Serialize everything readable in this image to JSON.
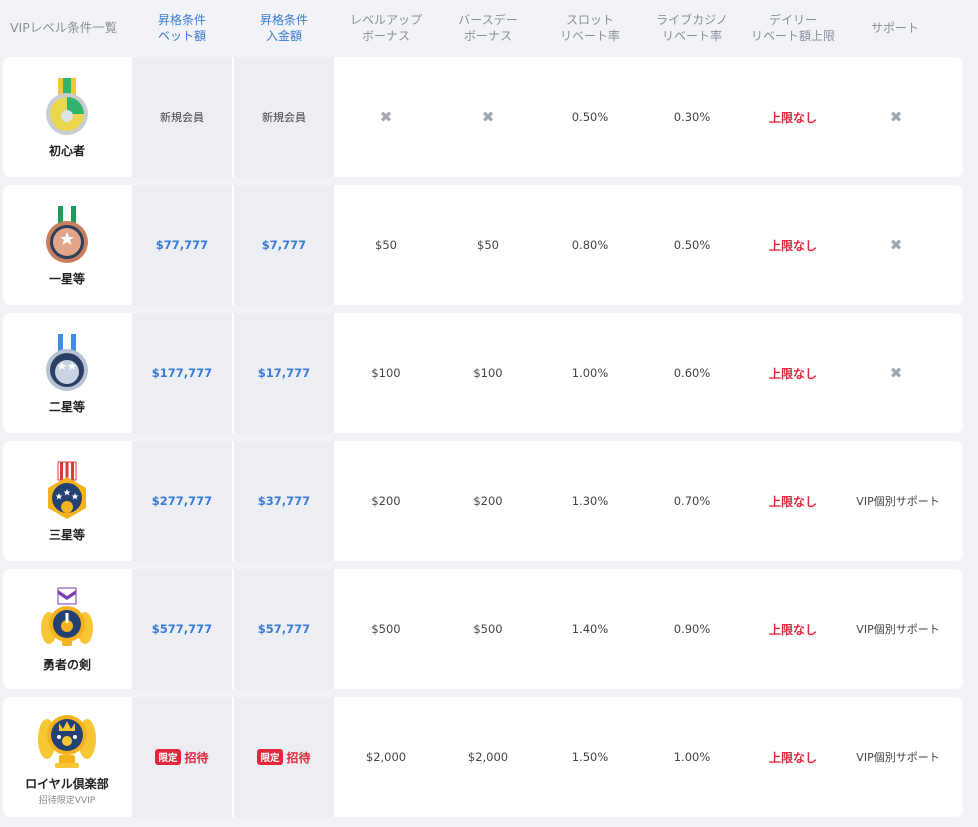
{
  "header": {
    "title": "VIPレベル条件一覧",
    "bet": [
      "昇格条件",
      "ベット額"
    ],
    "deposit": [
      "昇格条件",
      "入金額"
    ],
    "levelup": [
      "レベルアップ",
      "ボーナス"
    ],
    "birthday": [
      "バースデー",
      "ボーナス"
    ],
    "slot": [
      "スロット",
      "リベート率"
    ],
    "live": [
      "ライブカジノ",
      "リベート率"
    ],
    "daily": [
      "デイリー",
      "リベート額上限"
    ],
    "support": "サポート"
  },
  "rows": [
    {
      "name": "初心者",
      "sub": "",
      "bet": "新規会員",
      "deposit": "新規会員",
      "levelup": "✖",
      "birthday": "✖",
      "slot": "0.50%",
      "live": "0.30%",
      "daily": "上限なし",
      "support": "✖",
      "medal": "beginner-medal-icon"
    },
    {
      "name": "一星等",
      "sub": "",
      "bet": "$77,777",
      "deposit": "$7,777",
      "levelup": "$50",
      "birthday": "$50",
      "slot": "0.80%",
      "live": "0.50%",
      "daily": "上限なし",
      "support": "✖",
      "medal": "one-star-medal-icon"
    },
    {
      "name": "二星等",
      "sub": "",
      "bet": "$177,777",
      "deposit": "$17,777",
      "levelup": "$100",
      "birthday": "$100",
      "slot": "1.00%",
      "live": "0.60%",
      "daily": "上限なし",
      "support": "✖",
      "medal": "two-star-medal-icon"
    },
    {
      "name": "三星等",
      "sub": "",
      "bet": "$277,777",
      "deposit": "$37,777",
      "levelup": "$200",
      "birthday": "$200",
      "slot": "1.30%",
      "live": "0.70%",
      "daily": "上限なし",
      "support": "VIP個別サポート",
      "medal": "three-star-medal-icon"
    },
    {
      "name": "勇者の剣",
      "sub": "",
      "bet": "$577,777",
      "deposit": "$57,777",
      "levelup": "$500",
      "birthday": "$500",
      "slot": "1.40%",
      "live": "0.90%",
      "daily": "上限なし",
      "support": "VIP個別サポート",
      "medal": "hero-sword-medal-icon"
    },
    {
      "name": "ロイヤル倶楽部",
      "sub": "招待限定VVIP",
      "bet_badge": "限定",
      "bet": "招待",
      "deposit_badge": "限定",
      "deposit": "招待",
      "levelup": "$2,000",
      "birthday": "$2,000",
      "slot": "1.50%",
      "live": "1.00%",
      "daily": "上限なし",
      "support": "VIP個別サポート",
      "medal": "royal-club-medal-icon"
    }
  ],
  "colors": {
    "accent_blue": "#3a7bd5",
    "limit_red": "#e0283c",
    "req_cell_bg": "#eceef3",
    "page_bg": "#f2f3f6"
  }
}
